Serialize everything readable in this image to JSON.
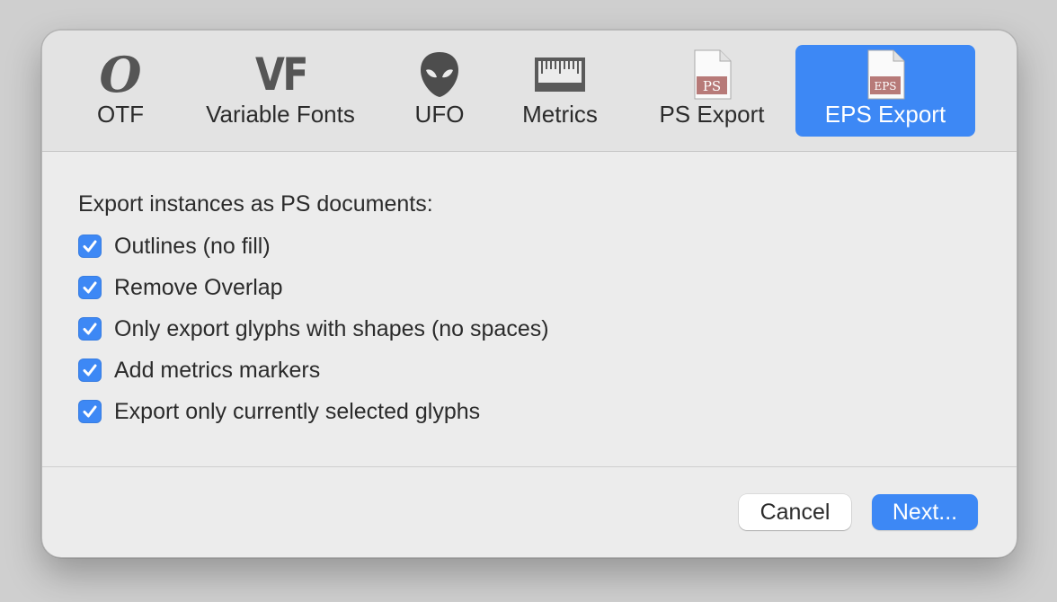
{
  "toolbar": {
    "tabs": [
      {
        "label": "OTF",
        "icon": "otf-icon",
        "glyph": "O"
      },
      {
        "label": "Variable Fonts",
        "icon": "vf-icon",
        "glyph": "VF"
      },
      {
        "label": "UFO",
        "icon": "ufo-alien-icon"
      },
      {
        "label": "Metrics",
        "icon": "ruler-icon"
      },
      {
        "label": "PS Export",
        "icon": "ps-document-icon",
        "badge": "PS"
      },
      {
        "label": "EPS Export",
        "icon": "eps-document-icon",
        "badge": "EPS"
      }
    ],
    "selected_tab": "EPS Export"
  },
  "content": {
    "heading": "Export instances as PS documents:",
    "options": [
      {
        "label": "Outlines (no fill)",
        "checked": true
      },
      {
        "label": "Remove Overlap",
        "checked": true
      },
      {
        "label": "Only export glyphs with shapes (no spaces)",
        "checked": true
      },
      {
        "label": "Add metrics markers",
        "checked": true
      },
      {
        "label": "Export only currently selected glyphs",
        "checked": true
      }
    ]
  },
  "buttons": {
    "cancel": "Cancel",
    "next": "Next..."
  },
  "colors": {
    "accent": "#3d88f5",
    "badge": "#b77a78"
  }
}
